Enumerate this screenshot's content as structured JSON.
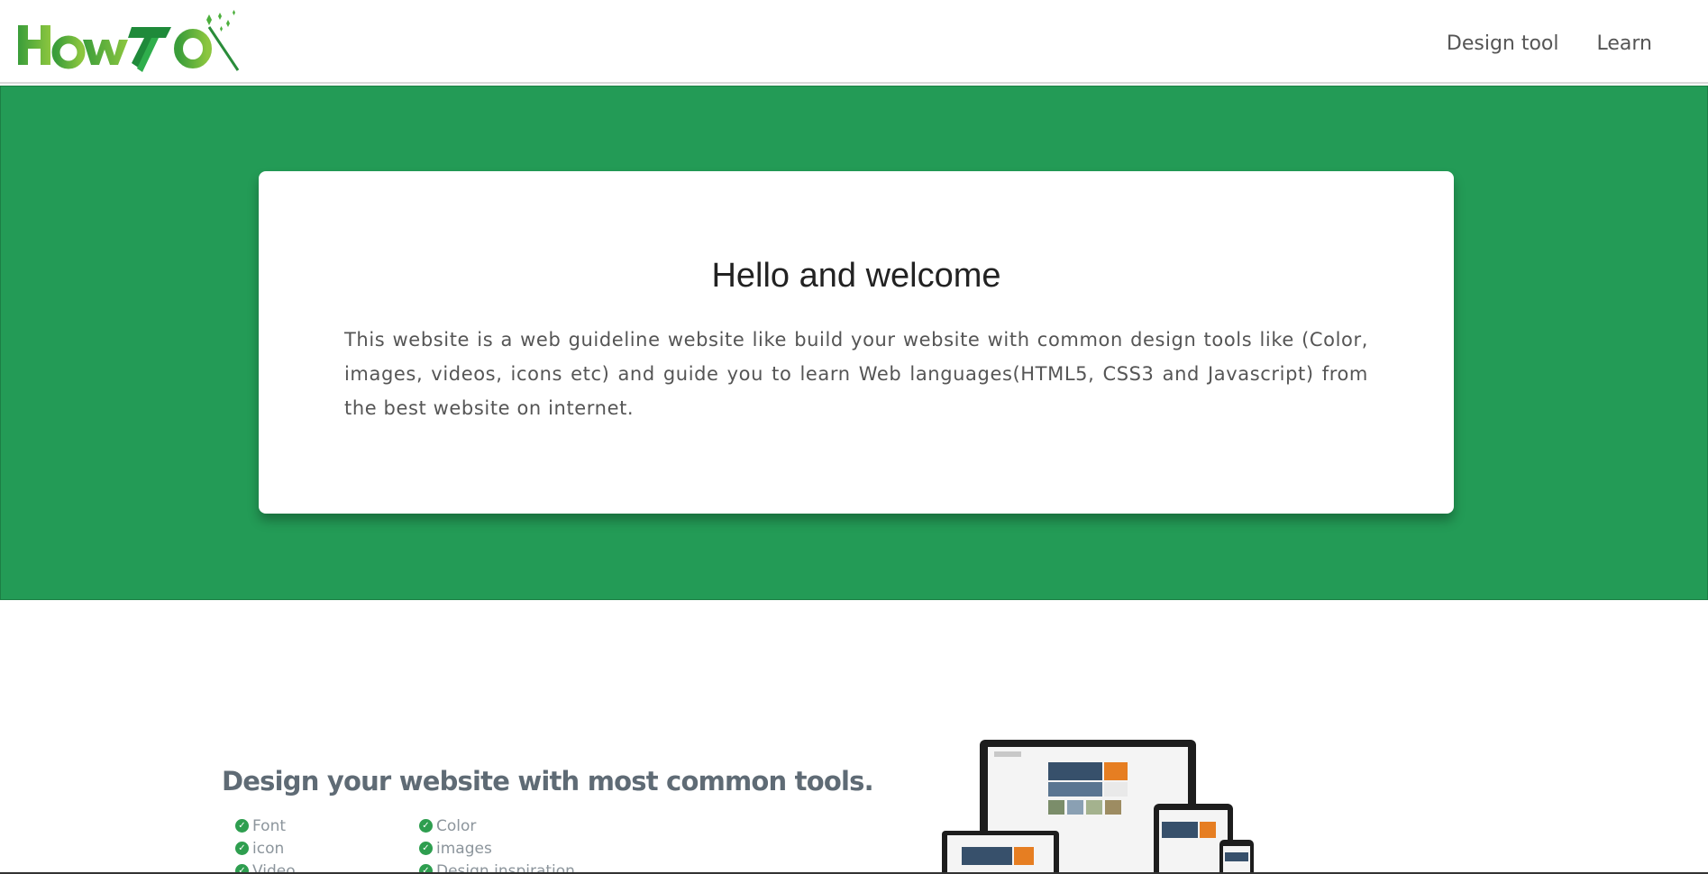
{
  "header": {
    "logo_text": "HowTo",
    "nav": [
      {
        "label": "Design tool"
      },
      {
        "label": "Learn"
      }
    ]
  },
  "hero": {
    "title": "Hello and welcome",
    "body": "This website is a web guideline website like build your website with common design tools like (Color, images, videos, icons etc) and guide you to learn Web languages(HTML5, CSS3 and Javascript) from the best website on internet."
  },
  "features": {
    "title": "Design your website with most common tools.",
    "col1": [
      "Font",
      "icon",
      "Video"
    ],
    "col2": [
      "Color",
      "images",
      "Design inspiration"
    ]
  },
  "colors": {
    "brand_green": "#239b56",
    "logo_green": "#4caf3c"
  }
}
